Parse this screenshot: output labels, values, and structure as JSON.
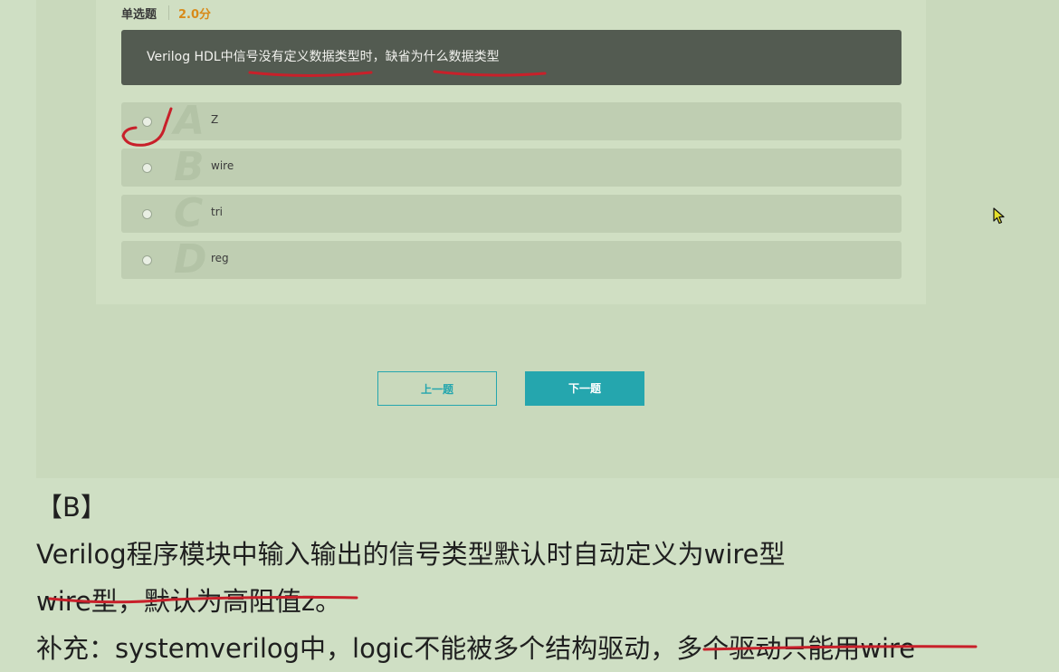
{
  "question": {
    "type_label": "单选题",
    "score": "2.0分",
    "stem": "Verilog HDL中信号没有定义数据类型时，缺省为什么数据类型"
  },
  "options": [
    {
      "letter": "A",
      "text": "Z"
    },
    {
      "letter": "B",
      "text": "wire"
    },
    {
      "letter": "C",
      "text": "tri"
    },
    {
      "letter": "D",
      "text": "reg"
    }
  ],
  "nav": {
    "prev_label": "上一题",
    "next_label": "下一题"
  },
  "notes": {
    "answer": "【B】",
    "line1": "Verilog程序模块中输入输出的信号类型默认时自动定义为wire型",
    "line2": "wire型，默认为高阻值z。",
    "line3": "补充：systemverilog中，logic不能被多个结构驱动，多个驱动只能用wire"
  },
  "colors": {
    "accent": "#25a6ae",
    "score": "#d88a19",
    "annotation": "#c8202a",
    "stem_bg": "#535b51"
  },
  "icons": {
    "cursor": "mouse-pointer-icon"
  }
}
